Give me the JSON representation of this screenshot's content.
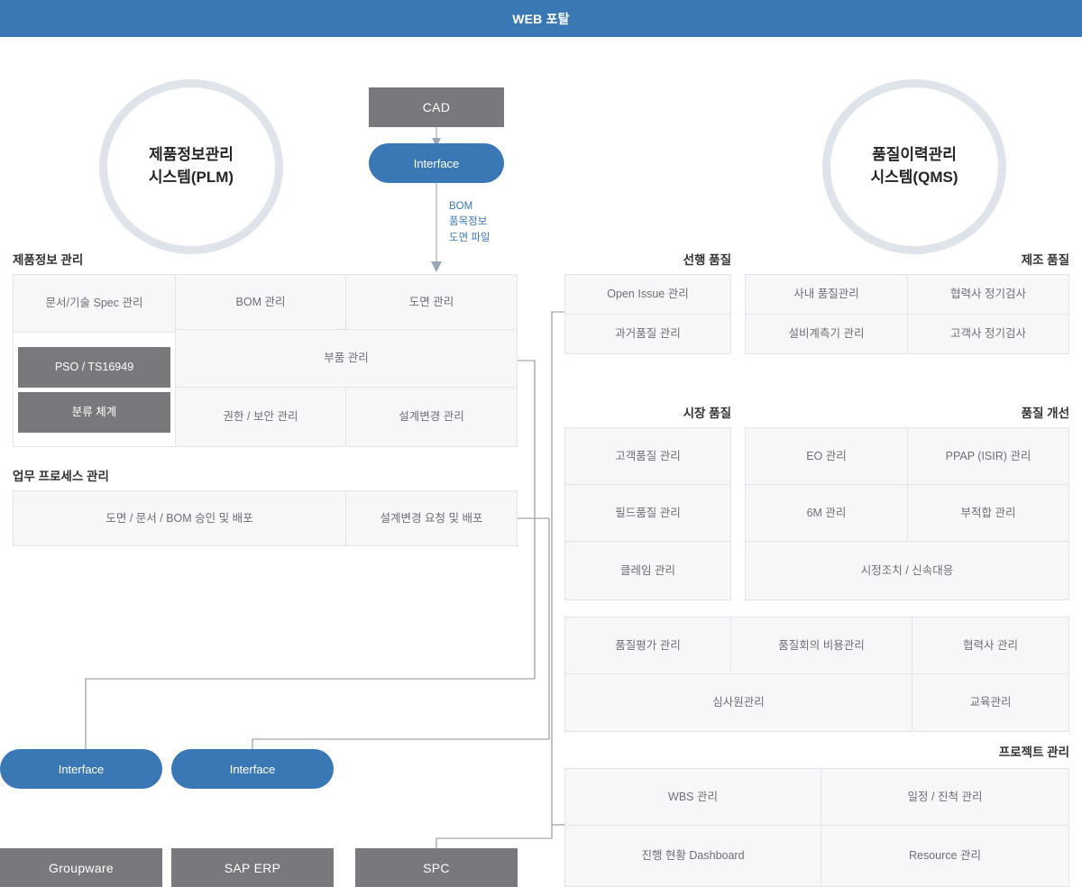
{
  "header": {
    "title": "WEB 포탈",
    "color": "#3a78b5"
  },
  "circles": {
    "plm": {
      "line1": "제품정보관리",
      "line2": "시스템(PLM)"
    },
    "qms": {
      "line1": "품질이력관리",
      "line2": "시스템(QMS)"
    }
  },
  "cad": {
    "box_label": "CAD",
    "interface_label": "Interface",
    "flow_label_line1": "BOM",
    "flow_label_line2": "품목정보",
    "flow_label_line3": "도면 파일"
  },
  "left": {
    "section1_title": "제품정보 관리",
    "section1_cells": [
      "문서/기술 Spec 관리",
      "PSO / TS16949",
      "분류 체계",
      "BOM 관리",
      "도면 관리",
      "부품 관리",
      "권한 / 보안 관리",
      "설계변경 관리"
    ],
    "section2_title": "업무 프로세스 관리",
    "section2_cells": [
      "도면 / 문서 / BOM 승인 및 배포",
      "설계변경 요청 및 배포"
    ]
  },
  "right": {
    "title_advance": "선행 품질",
    "title_manufacture": "제조 품질",
    "title_market": "시장 품질",
    "title_improve": "품질 개선",
    "title_project": "프로젝트 관리",
    "advance_cells": [
      "Open Issue 관리",
      "과거품질 관리"
    ],
    "manufacture_cells": [
      "사내 품질관리",
      "협력사 정기검사",
      "설비계측기 관리",
      "고객사 정기검사"
    ],
    "market_cells": [
      "고객품질 관리",
      "필드품질 관리",
      "클레임 관리"
    ],
    "improve_cells": [
      "EO 관리",
      "PPAP (ISIR) 관리",
      "6M 관리",
      "부적합 관리",
      "시정조치 / 신속대응"
    ],
    "common_cells": [
      "품질평가 관리",
      "품질회의 비용관리",
      "협력사 관리",
      "심사원관리",
      "교육관리"
    ],
    "project_cells": [
      "WBS 관리",
      "일정 / 진척 관리",
      "진행 현황 Dashboard",
      "Resource 관리"
    ]
  },
  "bottom": {
    "interface_left": "Interface",
    "interface_mid": "Interface",
    "systems": [
      "Groupware",
      "SAP ERP",
      "SPC"
    ]
  },
  "colors": {
    "brand_blue": "#3a78b5",
    "grey_box": "#79797d",
    "cell_bg": "#f6f7f9",
    "cell_border": "#e2e4e9",
    "ring_border": "#dfe3ea",
    "wire": "#8d9096"
  }
}
